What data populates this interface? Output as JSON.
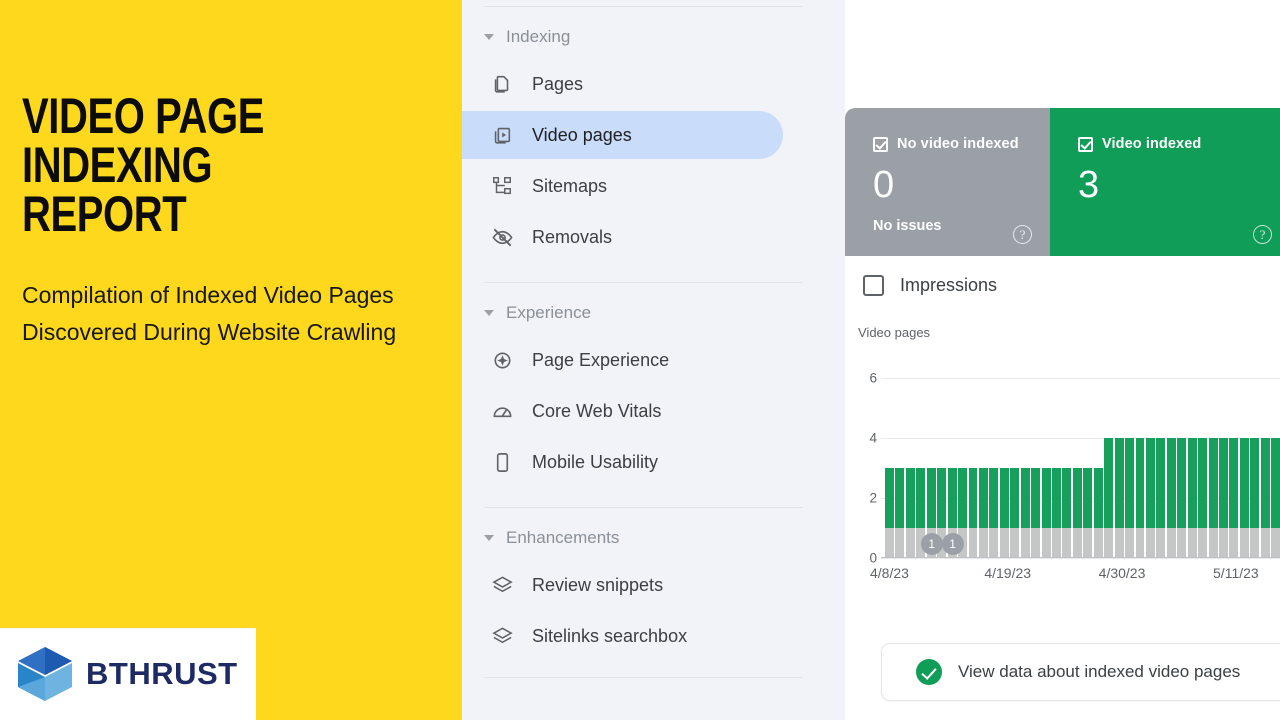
{
  "promo": {
    "title_line1": "VIDEO PAGE",
    "title_line2": "INDEXING REPORT",
    "subtitle": "Compilation of Indexed Video Pages Discovered During Website Crawling",
    "brand_name": "BTHRUST",
    "yellow": "#FDD81D",
    "brand_blue": "#1d2a63"
  },
  "sidebar": {
    "groups": [
      {
        "label": "Indexing",
        "items": [
          {
            "label": "Pages",
            "icon": "pages-copy-icon",
            "active": false
          },
          {
            "label": "Video pages",
            "icon": "video-pages-icon",
            "active": true
          },
          {
            "label": "Sitemaps",
            "icon": "sitemaps-icon",
            "active": false
          },
          {
            "label": "Removals",
            "icon": "eye-off-icon",
            "active": false
          }
        ]
      },
      {
        "label": "Experience",
        "items": [
          {
            "label": "Page Experience",
            "icon": "page-experience-icon",
            "active": false
          },
          {
            "label": "Core Web Vitals",
            "icon": "speedometer-icon",
            "active": false
          },
          {
            "label": "Mobile Usability",
            "icon": "mobile-phone-icon",
            "active": false
          }
        ]
      },
      {
        "label": "Enhancements",
        "items": [
          {
            "label": "Review snippets",
            "icon": "layers-icon",
            "active": false
          },
          {
            "label": "Sitelinks searchbox",
            "icon": "layers-icon",
            "active": false
          }
        ]
      }
    ]
  },
  "main": {
    "status_cards": [
      {
        "title": "No video indexed",
        "value": "0",
        "subtext": "No issues",
        "help": "?",
        "color": "#9AA0A6",
        "checkbox_checked": true
      },
      {
        "title": "Video indexed",
        "value": "3",
        "subtext": "",
        "help": "?",
        "color": "#109D57",
        "checkbox_checked": true
      }
    ],
    "legend": {
      "label": "Impressions",
      "checked": false
    },
    "info_card": {
      "text": "View data about indexed video pages",
      "status": "success"
    }
  },
  "chart_data": {
    "type": "bar",
    "title": "",
    "ylabel": "Video pages",
    "xlabel": "",
    "ylim": [
      0,
      6
    ],
    "yticks": [
      0,
      2,
      4,
      6
    ],
    "grid": true,
    "stacked": true,
    "legend_position": "top-left",
    "xtick_labels": [
      "4/8/23",
      "4/19/23",
      "4/30/23",
      "5/11/23"
    ],
    "xtick_positions": [
      0,
      11,
      22,
      33
    ],
    "colors": {
      "video_indexed": "#17A05C",
      "no_video_indexed": "#C4C7C5"
    },
    "annotations": [
      {
        "index": 4,
        "label": "1"
      },
      {
        "index": 6,
        "label": "1"
      }
    ],
    "series": [
      {
        "name": "No video indexed",
        "values": [
          1,
          1,
          1,
          1,
          1,
          1,
          1,
          1,
          1,
          1,
          1,
          1,
          1,
          1,
          1,
          1,
          1,
          1,
          1,
          1,
          1,
          1,
          1,
          1,
          1,
          1,
          1,
          1,
          1,
          1,
          1,
          1,
          1,
          1,
          1,
          1,
          1,
          1
        ]
      },
      {
        "name": "Video indexed",
        "values": [
          2,
          2,
          2,
          2,
          2,
          2,
          2,
          2,
          2,
          2,
          2,
          2,
          2,
          2,
          2,
          2,
          2,
          2,
          2,
          2,
          2,
          3,
          3,
          3,
          3,
          3,
          3,
          3,
          3,
          3,
          3,
          3,
          3,
          3,
          3,
          3,
          3,
          3
        ]
      }
    ],
    "totals": [
      3,
      3,
      3,
      3,
      3,
      3,
      3,
      3,
      3,
      3,
      3,
      3,
      3,
      3,
      3,
      3,
      3,
      3,
      3,
      3,
      3,
      4,
      4,
      4,
      4,
      4,
      4,
      4,
      4,
      4,
      4,
      4,
      4,
      4,
      4,
      4,
      4,
      4
    ]
  }
}
